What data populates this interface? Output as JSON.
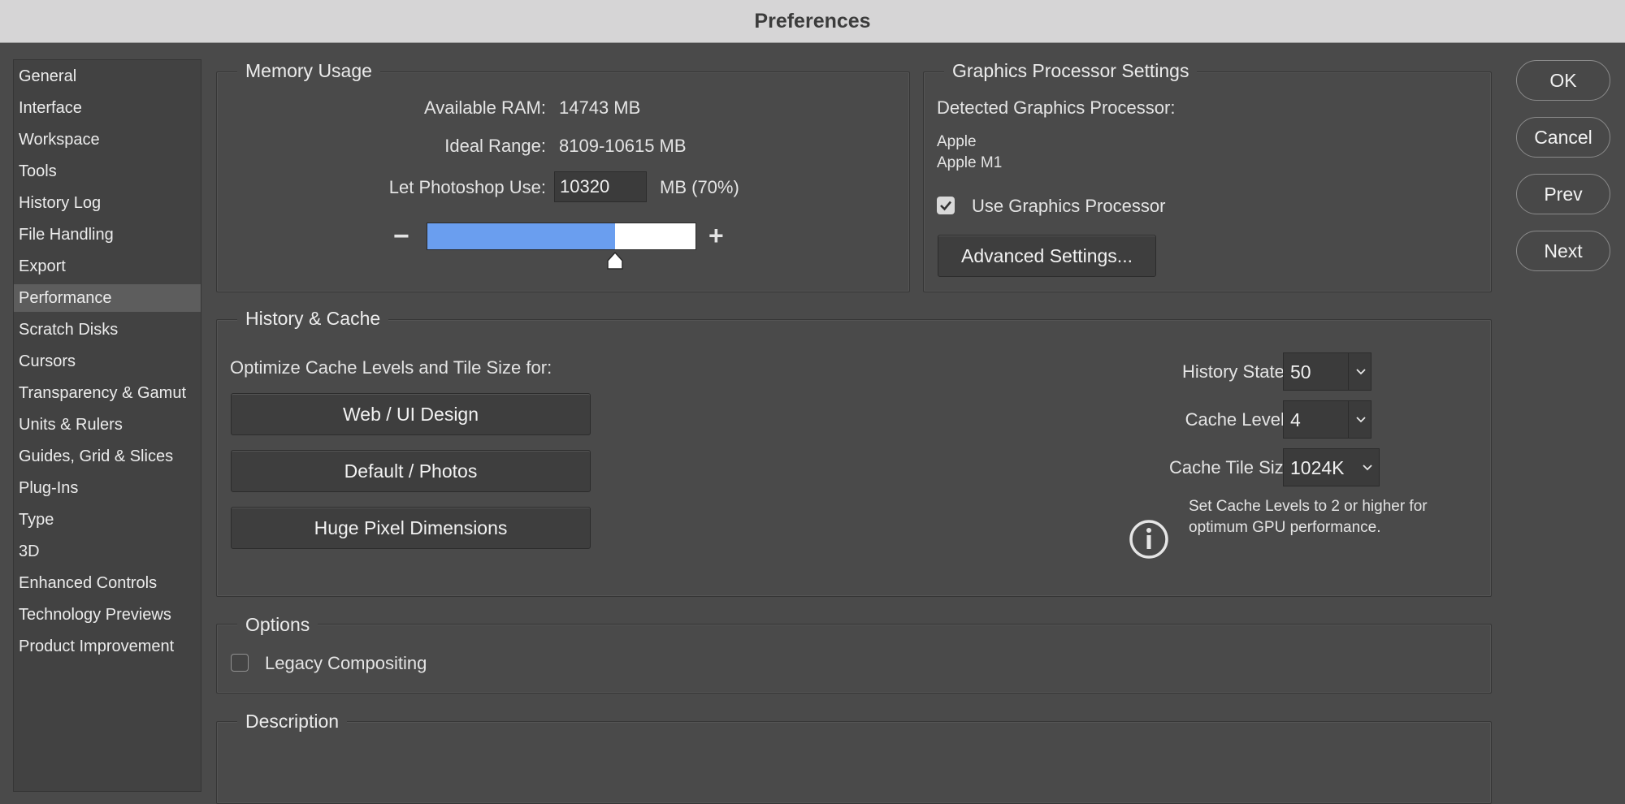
{
  "window": {
    "title": "Preferences"
  },
  "sidebar": {
    "items": [
      {
        "label": "General"
      },
      {
        "label": "Interface"
      },
      {
        "label": "Workspace"
      },
      {
        "label": "Tools"
      },
      {
        "label": "History Log"
      },
      {
        "label": "File Handling"
      },
      {
        "label": "Export"
      },
      {
        "label": "Performance"
      },
      {
        "label": "Scratch Disks"
      },
      {
        "label": "Cursors"
      },
      {
        "label": "Transparency & Gamut"
      },
      {
        "label": "Units & Rulers"
      },
      {
        "label": "Guides, Grid & Slices"
      },
      {
        "label": "Plug-Ins"
      },
      {
        "label": "Type"
      },
      {
        "label": "3D"
      },
      {
        "label": "Enhanced Controls"
      },
      {
        "label": "Technology Previews"
      },
      {
        "label": "Product Improvement"
      }
    ],
    "selected": "Performance"
  },
  "memory": {
    "title": "Memory Usage",
    "available_label": "Available RAM:",
    "available_value": "14743 MB",
    "ideal_label": "Ideal Range:",
    "ideal_value": "8109-10615 MB",
    "use_label": "Let Photoshop Use:",
    "use_value": "10320",
    "use_suffix": "MB (70%)",
    "slider_percent": 70,
    "minus": "−",
    "plus": "+"
  },
  "gpu": {
    "title": "Graphics Processor Settings",
    "detected_label": "Detected Graphics Processor:",
    "vendor": "Apple",
    "model": "Apple M1",
    "use_gpu_label": "Use Graphics Processor",
    "use_gpu_checked": true,
    "advanced_button": "Advanced Settings..."
  },
  "history_cache": {
    "title": "History & Cache",
    "optimize_label": "Optimize Cache Levels and Tile Size for:",
    "buttons": [
      "Web / UI Design",
      "Default / Photos",
      "Huge Pixel Dimensions"
    ],
    "history_states_label": "History States:",
    "history_states_value": "50",
    "cache_levels_label": "Cache Levels:",
    "cache_levels_value": "4",
    "tile_size_label": "Cache Tile Size:",
    "tile_size_value": "1024K",
    "info_text_1": "Set Cache Levels to 2 or higher for",
    "info_text_2": "optimum GPU performance."
  },
  "options": {
    "title": "Options",
    "legacy_label": "Legacy Compositing",
    "legacy_checked": false
  },
  "description": {
    "title": "Description"
  },
  "actions": {
    "ok": "OK",
    "cancel": "Cancel",
    "prev": "Prev",
    "next": "Next"
  },
  "colors": {
    "accent": "#6a9eef",
    "panel": "#4a4a4a"
  }
}
